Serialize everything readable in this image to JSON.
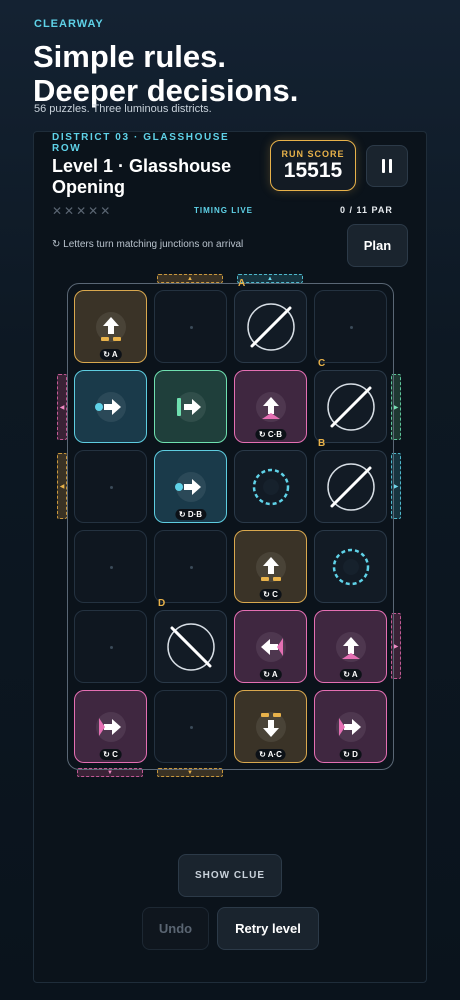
{
  "app": {
    "brand": "CLEARWAY"
  },
  "hero": {
    "headline_line1": "Simple rules.",
    "headline_line2": "Deeper decisions.",
    "subline": "56 puzzles. Three luminous districts."
  },
  "level": {
    "district": "DISTRICT 03 · GLASSHOUSE ROW",
    "title": "Level 1 · Glasshouse Opening",
    "score_label": "RUN SCORE",
    "score_value": "15515",
    "stars": "✕✕✕✕✕",
    "timing": "TIMING LIVE",
    "par": "0 / 11 PAR",
    "hint": "↻ Letters turn matching junctions on arrival",
    "plan_label": "Plan"
  },
  "board": {
    "cells": [
      {
        "row": 0,
        "col": 0,
        "kind": "gold",
        "icon": "arrow-up-icon",
        "tag": "↻ A"
      },
      {
        "row": 0,
        "col": 1,
        "kind": "empty"
      },
      {
        "row": 0,
        "col": 2,
        "kind": "dark",
        "icon": "mirror-forward-icon",
        "letter": "A"
      },
      {
        "row": 0,
        "col": 3,
        "kind": "empty"
      },
      {
        "row": 1,
        "col": 0,
        "kind": "teal",
        "icon": "source-right-icon"
      },
      {
        "row": 1,
        "col": 1,
        "kind": "green",
        "icon": "gate-right-icon"
      },
      {
        "row": 1,
        "col": 2,
        "kind": "pink",
        "icon": "arrow-up-icon",
        "tag": "↻ C·B"
      },
      {
        "row": 1,
        "col": 3,
        "kind": "dark",
        "icon": "mirror-forward-icon",
        "letter": "C"
      },
      {
        "row": 2,
        "col": 0,
        "kind": "empty"
      },
      {
        "row": 2,
        "col": 1,
        "kind": "teal",
        "icon": "source-right-icon",
        "tag": "↻ D·B"
      },
      {
        "row": 2,
        "col": 2,
        "kind": "dark",
        "icon": "target-ring-icon"
      },
      {
        "row": 2,
        "col": 3,
        "kind": "dark",
        "icon": "mirror-forward-icon",
        "letter": "B"
      },
      {
        "row": 3,
        "col": 0,
        "kind": "empty"
      },
      {
        "row": 3,
        "col": 1,
        "kind": "empty"
      },
      {
        "row": 3,
        "col": 2,
        "kind": "gold",
        "icon": "arrow-up-icon",
        "tag": "↻ C"
      },
      {
        "row": 3,
        "col": 3,
        "kind": "dark",
        "icon": "target-ring-icon"
      },
      {
        "row": 4,
        "col": 0,
        "kind": "empty"
      },
      {
        "row": 4,
        "col": 1,
        "kind": "dark",
        "icon": "mirror-back-icon",
        "letter": "D"
      },
      {
        "row": 4,
        "col": 2,
        "kind": "pink",
        "icon": "arrow-left-icon",
        "tag": "↻ A"
      },
      {
        "row": 4,
        "col": 3,
        "kind": "pink",
        "icon": "arrow-up-icon",
        "tag": "↻ A"
      },
      {
        "row": 5,
        "col": 0,
        "kind": "pink",
        "icon": "arrow-right-icon",
        "tag": "↻ C"
      },
      {
        "row": 5,
        "col": 1,
        "kind": "empty"
      },
      {
        "row": 5,
        "col": 2,
        "kind": "gold",
        "icon": "arrow-down-icon",
        "tag": "↻ A·C"
      },
      {
        "row": 5,
        "col": 3,
        "kind": "pink",
        "icon": "arrow-right-icon",
        "tag": "↻ D"
      }
    ]
  },
  "controls": {
    "show_clue": "SHOW CLUE",
    "undo": "Undo",
    "retry": "Retry level"
  },
  "colors": {
    "accent_cyan": "#5fd2e8",
    "accent_gold": "#e8b24a",
    "accent_pink": "#e46fb3",
    "accent_green": "#6fe0b0"
  }
}
